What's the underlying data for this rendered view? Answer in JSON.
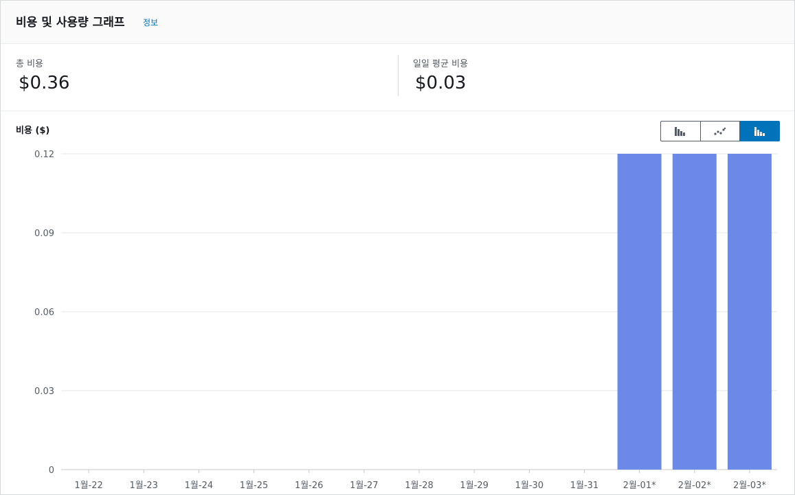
{
  "header": {
    "title": "비용 및 사용량 그래프",
    "info_link": "정보"
  },
  "summary": {
    "total_label": "총 비용",
    "total_value": "$0.36",
    "daily_avg_label": "일일 평균 비용",
    "daily_avg_value": "$0.03"
  },
  "chart_toolbar": {
    "buttons": [
      {
        "icon": "bar-chart-icon",
        "selected": false
      },
      {
        "icon": "line-chart-icon",
        "selected": false
      },
      {
        "icon": "stacked-bar-chart-icon",
        "selected": true
      }
    ]
  },
  "colors": {
    "bar": "#6b8ae8",
    "accent": "#0073bb",
    "grid": "#e6e6e6"
  },
  "chart_data": {
    "type": "bar",
    "title": "",
    "ylabel": "비용 ($)",
    "xlabel": "",
    "categories": [
      "1월-22",
      "1월-23",
      "1월-24",
      "1월-25",
      "1월-26",
      "1월-27",
      "1월-28",
      "1월-29",
      "1월-30",
      "1월-31",
      "2월-01*",
      "2월-02*",
      "2월-03*"
    ],
    "values": [
      0,
      0,
      0,
      0,
      0,
      0,
      0,
      0,
      0,
      0,
      0.12,
      0.12,
      0.12
    ],
    "ylim": [
      0,
      0.12
    ],
    "yticks": [
      "0",
      "0.03",
      "0.06",
      "0.09",
      "0.12"
    ],
    "grid": true,
    "legend": "none"
  }
}
